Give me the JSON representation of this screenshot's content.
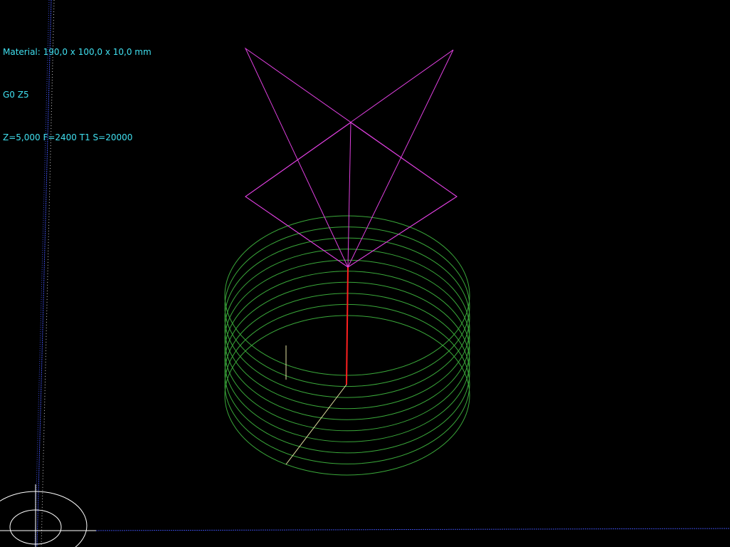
{
  "hud": {
    "material": "Material: 190,0 x 100,0 x 10,0 mm",
    "gcode_line": "G0 Z5",
    "machine_state": "Z=5,000 F=2400 T1 S=20000"
  },
  "colors": {
    "background": "#000000",
    "hud_text": "#40e0f0",
    "toolpath": "#3aa83a",
    "tool": "#e040e0",
    "tool_axis": "#ff2020",
    "material_axis": "#e0e0a0",
    "origin_marker": "#ffffff",
    "grid_blue": "#3a4ad8",
    "grid_white": "#c8c8c8"
  },
  "toolpath": {
    "type": "helix",
    "passes": 10
  },
  "icons": {
    "tool": "tool-cone-icon",
    "origin": "origin-marker-icon"
  }
}
